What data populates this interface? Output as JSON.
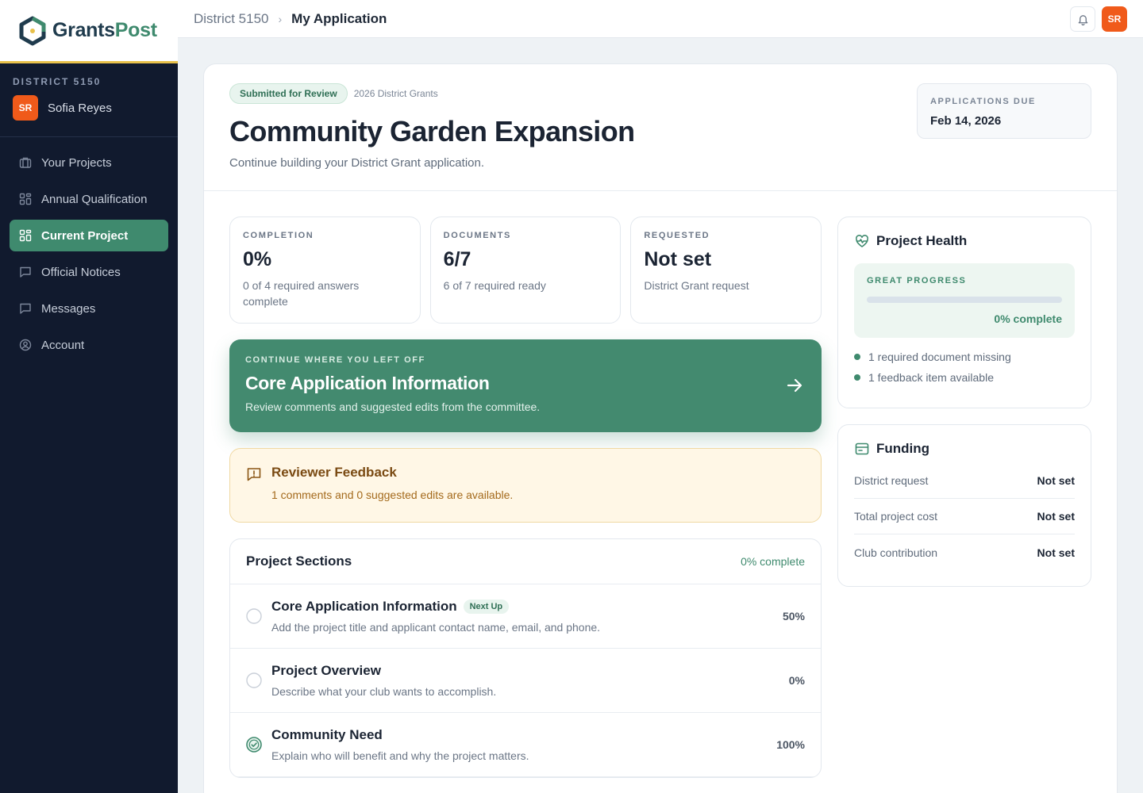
{
  "brand": {
    "name_a": "Grants",
    "name_b": "Post"
  },
  "sidebar": {
    "district_label": "DISTRICT 5150",
    "user": {
      "initials": "SR",
      "name": "Sofia Reyes"
    },
    "items": [
      {
        "label": "Your Projects",
        "icon": "briefcase-icon",
        "active": false
      },
      {
        "label": "Annual Qualification",
        "icon": "grid-icon",
        "active": false
      },
      {
        "label": "Current Project",
        "icon": "grid-icon",
        "active": true
      },
      {
        "label": "Official Notices",
        "icon": "message-square-icon",
        "active": false
      },
      {
        "label": "Messages",
        "icon": "message-square-icon",
        "active": false
      },
      {
        "label": "Account",
        "icon": "user-circle-icon",
        "active": false
      }
    ]
  },
  "topbar": {
    "breadcrumb_root": "District 5150",
    "breadcrumb_current": "My Application",
    "avatar_initials": "SR"
  },
  "header": {
    "status": "Submitted for Review",
    "program": "2026 District Grants",
    "title": "Community Garden Expansion",
    "subtitle": "Continue building your District Grant application.",
    "due_label": "APPLICATIONS DUE",
    "due_value": "Feb 14, 2026"
  },
  "stats": [
    {
      "label": "COMPLETION",
      "value": "0%",
      "desc": "0 of 4 required answers complete"
    },
    {
      "label": "DOCUMENTS",
      "value": "6/7",
      "desc": "6 of 7 required ready"
    },
    {
      "label": "REQUESTED",
      "value": "Not set",
      "desc": "District Grant request"
    }
  ],
  "continue_card": {
    "label": "CONTINUE WHERE YOU LEFT OFF",
    "title": "Core Application Information",
    "desc": "Review comments and suggested edits from the committee."
  },
  "feedback": {
    "title": "Reviewer Feedback",
    "desc": "1 comments and 0 suggested edits are available."
  },
  "sections": {
    "title": "Project Sections",
    "complete": "0% complete",
    "rows": [
      {
        "title": "Core Application Information",
        "badge": "Next Up",
        "desc": "Add the project title and applicant contact name, email, and phone.",
        "pct": "50%",
        "done": false
      },
      {
        "title": "Project Overview",
        "badge": "",
        "desc": "Describe what your club wants to accomplish.",
        "pct": "0%",
        "done": false
      },
      {
        "title": "Community Need",
        "badge": "",
        "desc": "Explain who will benefit and why the project matters.",
        "pct": "100%",
        "done": true
      }
    ]
  },
  "health": {
    "title": "Project Health",
    "progress_label": "GREAT PROGRESS",
    "progress_pct": "0% complete",
    "progress_value": 0,
    "items": [
      "1 required document missing",
      "1 feedback item available"
    ]
  },
  "funding": {
    "title": "Funding",
    "rows": [
      {
        "label": "District request",
        "value": "Not set"
      },
      {
        "label": "Total project cost",
        "value": "Not set"
      },
      {
        "label": "Club contribution",
        "value": "Not set"
      }
    ]
  },
  "colors": {
    "accent": "#3f8a6e",
    "sidebar": "#111a2e",
    "avatar": "#f05a1a",
    "warning_bg": "#fff7e6"
  }
}
